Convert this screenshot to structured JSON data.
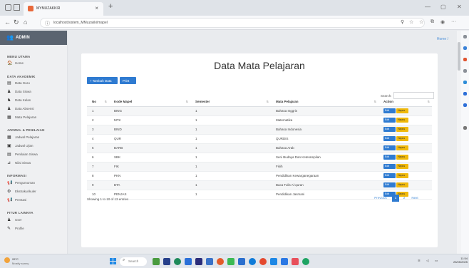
{
  "browser": {
    "tab_title": "MYMUZAKKIR",
    "url": "localhost/sistem_MMuzakki/mapel",
    "new_tab": "+",
    "close_tab": "×"
  },
  "sidebar": {
    "brand": "ADMIN",
    "sections": [
      {
        "title": "MENU UTAMA",
        "items": [
          {
            "label": "Home",
            "icon": "home-icon"
          }
        ]
      },
      {
        "title": "DATA AKADEMIK",
        "items": [
          {
            "label": "Data Guru",
            "icon": "teacher-icon"
          },
          {
            "label": "Data Siswa",
            "icon": "student-icon"
          },
          {
            "label": "Data Kelas",
            "icon": "class-icon"
          },
          {
            "label": "Data Absensi",
            "icon": "attendance-icon"
          },
          {
            "label": "Mata Pelajaran",
            "icon": "book-icon"
          }
        ]
      },
      {
        "title": "JADWAL & PENILAIAN",
        "items": [
          {
            "label": "Jadwal Pelajaran",
            "icon": "calendar-icon"
          },
          {
            "label": "Jadwal Ujian",
            "icon": "exam-icon"
          },
          {
            "label": "Penilaian Siswa",
            "icon": "grade-icon"
          },
          {
            "label": "Nilai Siswa",
            "icon": "chart-icon"
          }
        ]
      },
      {
        "title": "INFORMASI",
        "items": [
          {
            "label": "Pengumuman",
            "icon": "announcement-icon"
          },
          {
            "label": "Ekstrakurikuler",
            "icon": "activity-icon"
          },
          {
            "label": "Prestasi",
            "icon": "trophy-icon"
          }
        ]
      },
      {
        "title": "FITUR LAINNYA",
        "items": [
          {
            "label": "User",
            "icon": "user-icon"
          },
          {
            "label": "Profile",
            "icon": "profile-icon"
          }
        ]
      }
    ]
  },
  "breadcrumb": "Home /",
  "page": {
    "title": "Data Mata Pelajaran",
    "add_button": "+ Tambah Data",
    "print_button": "Print",
    "search_label": "Search:",
    "search_value": ""
  },
  "table": {
    "headers": [
      "No",
      "Kode Mapel",
      "Semester",
      "Mata Pelajaran",
      "Action"
    ],
    "edit_label": "Edit",
    "delete_label": "Hapus",
    "rows": [
      [
        "1",
        "BING",
        "1",
        "Bahasa Inggris"
      ],
      [
        "2",
        "MTK",
        "1",
        "Matematika"
      ],
      [
        "3",
        "BIND",
        "1",
        "Bahasa Indonesia"
      ],
      [
        "4",
        "QUR",
        "1",
        "QURDIS"
      ],
      [
        "5",
        "BARB",
        "1",
        "Bahasa Arab"
      ],
      [
        "6",
        "SBK",
        "1",
        "Seni Budaya Dan Keterampilan"
      ],
      [
        "7",
        "FIK",
        "1",
        "Fikih"
      ],
      [
        "8",
        "PKN",
        "1",
        "Pendidikan Kewarganegaraan"
      ],
      [
        "9",
        "BTA",
        "1",
        "Baca Tulis Al-quran"
      ],
      [
        "10",
        "PENJAS",
        "1",
        "Pendidikan Jasmani"
      ]
    ]
  },
  "footer": {
    "showing": "Showing 1 to 10 of 13 entries",
    "pagination": [
      "Previous",
      "1",
      "2",
      "Next"
    ],
    "active_page": "1"
  },
  "taskbar": {
    "weather_temp": "26°C",
    "weather_desc": "Mostly sunny",
    "search_placeholder": "Search",
    "time": "11:54",
    "date": "25/05/2025"
  },
  "colors": {
    "primary": "#2f7bd1",
    "warning": "#f0b90b",
    "brand_bar": "#5b6470"
  }
}
